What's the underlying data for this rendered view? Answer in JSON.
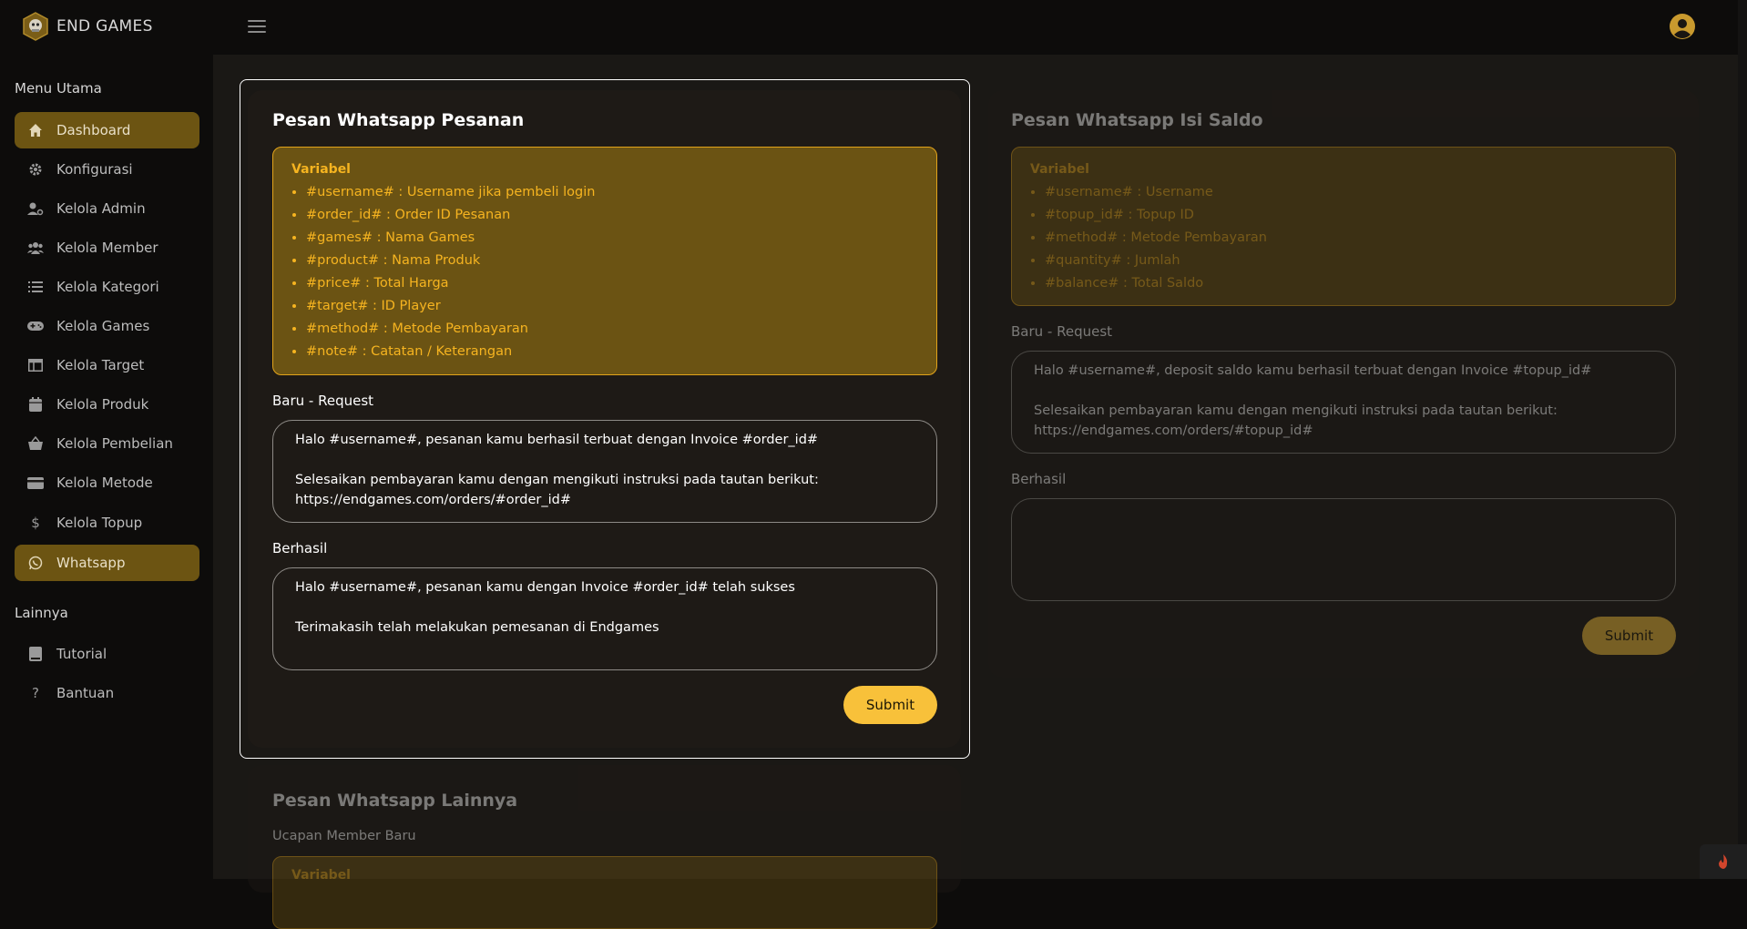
{
  "app": {
    "name": "END GAMES"
  },
  "sidebar": {
    "section_main": "Menu Utama",
    "section_other": "Lainnya",
    "items": [
      {
        "label": "Dashboard",
        "icon": "home-icon",
        "active": true
      },
      {
        "label": "Konfigurasi",
        "icon": "gear-icon",
        "active": false
      },
      {
        "label": "Kelola Admin",
        "icon": "user-gear-icon",
        "active": false
      },
      {
        "label": "Kelola Member",
        "icon": "users-icon",
        "active": false
      },
      {
        "label": "Kelola Kategori",
        "icon": "list-icon",
        "active": false
      },
      {
        "label": "Kelola Games",
        "icon": "gamepad-icon",
        "active": false
      },
      {
        "label": "Kelola Target",
        "icon": "table-icon",
        "active": false
      },
      {
        "label": "Kelola Produk",
        "icon": "calendar-icon",
        "active": false
      },
      {
        "label": "Kelola Pembelian",
        "icon": "basket-icon",
        "active": false
      },
      {
        "label": "Kelola Metode",
        "icon": "credit-card-icon",
        "active": false
      },
      {
        "label": "Kelola Topup",
        "icon": "dollar-icon",
        "active": false
      },
      {
        "label": "Whatsapp",
        "icon": "whatsapp-icon",
        "active": true
      }
    ],
    "other_items": [
      {
        "label": "Tutorial",
        "icon": "book-icon"
      },
      {
        "label": "Bantuan",
        "icon": "question-icon"
      }
    ]
  },
  "order_card": {
    "title": "Pesan Whatsapp Pesanan",
    "variables_title": "Variabel",
    "variables": [
      "#username# : Username jika pembeli login",
      "#order_id# : Order ID Pesanan",
      "#games# : Nama Games",
      "#product# : Nama Produk",
      "#price# : Total Harga",
      "#target# : ID Player",
      "#method# : Metode Pembayaran",
      "#note# : Catatan / Keterangan"
    ],
    "request_label": "Baru - Request",
    "request_value": "Halo #username#, pesanan kamu berhasil terbuat dengan Invoice  #order_id#\n\nSelesaikan pembayaran kamu dengan mengikuti instruksi pada tautan berikut:\nhttps://endgames.com/orders/#order_id#",
    "success_label": "Berhasil",
    "success_value": "Halo #username#, pesanan kamu dengan Invoice  #order_id# telah sukses\n\nTerimakasih telah melakukan pemesanan di Endgames",
    "submit_label": "Submit"
  },
  "topup_card": {
    "title": "Pesan Whatsapp Isi Saldo",
    "variables_title": "Variabel",
    "variables": [
      "#username# : Username",
      "#topup_id# : Topup ID",
      "#method# : Metode Pembayaran",
      "#quantity# : Jumlah",
      "#balance# : Total Saldo"
    ],
    "request_label": "Baru - Request",
    "request_value": "Halo #username#, deposit saldo kamu berhasil terbuat dengan Invoice  #topup_id#\n\nSelesaikan pembayaran kamu dengan mengikuti instruksi pada tautan berikut:\nhttps://endgames.com/orders/#topup_id#",
    "success_label": "Berhasil",
    "success_value": "",
    "submit_label": "Submit"
  },
  "other_card": {
    "title": "Pesan Whatsapp Lainnya",
    "subtitle": "Ucapan Member Baru",
    "variables_title": "Variabel"
  },
  "colors": {
    "accent": "#f8c13a",
    "variable_box": "#6b5313",
    "active_nav": "#6c5412",
    "background": "#0d0c0b"
  }
}
